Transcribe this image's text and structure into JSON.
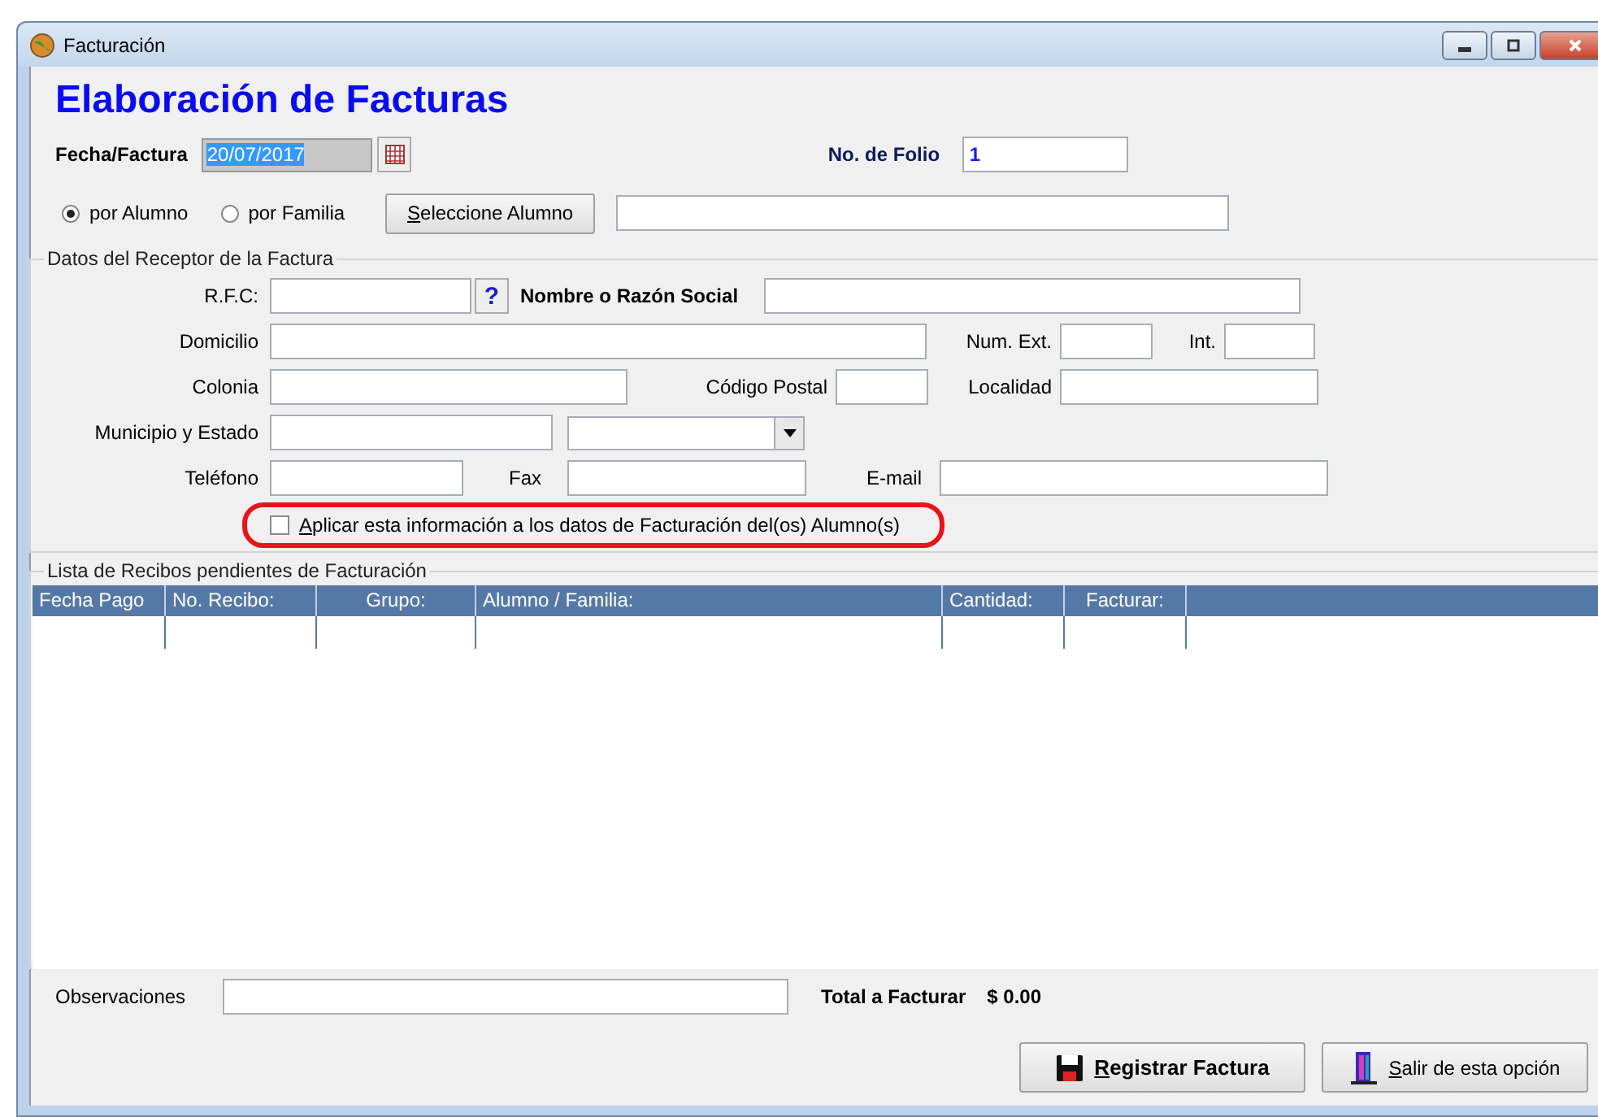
{
  "window": {
    "title": "Facturación"
  },
  "heading": "Elaboración de Facturas",
  "fecha": {
    "label": "Fecha/Factura",
    "value": "20/07/2017"
  },
  "folio": {
    "label": "No. de Folio",
    "value": "1"
  },
  "mode_options": [
    {
      "label": "por Alumno",
      "selected": true
    },
    {
      "label": "por Familia",
      "selected": false
    }
  ],
  "select_button": "Seleccione Alumno",
  "receptor": {
    "title": "Datos del Receptor de la Factura",
    "rfc_label": "R.F.C:",
    "help_button": "?",
    "nombre_label": "Nombre o Razón Social",
    "domicilio_label": "Domicilio",
    "num_ext_label": "Num. Ext.",
    "int_label": "Int.",
    "colonia_label": "Colonia",
    "cp_label": "Código Postal",
    "localidad_label": "Localidad",
    "municipio_label": "Municipio y Estado",
    "telefono_label": "Teléfono",
    "fax_label": "Fax",
    "email_label": "E-mail",
    "apply_checkbox": {
      "label": "Aplicar esta información a los datos de Facturación del(os) Alumno(s)",
      "checked": false
    }
  },
  "recibos": {
    "title": "Lista de Recibos pendientes de Facturación",
    "columns": [
      "Fecha Pago",
      "No. Recibo:",
      "Grupo:",
      "Alumno / Familia:",
      "Cantidad:",
      "Facturar:"
    ]
  },
  "observaciones_label": "Observaciones",
  "total": {
    "label": "Total a Facturar",
    "value": "$ 0.00"
  },
  "buttons": [
    {
      "kind": "save",
      "label": "Registrar Factura"
    },
    {
      "kind": "exit",
      "label": "Salir de esta opción"
    }
  ]
}
